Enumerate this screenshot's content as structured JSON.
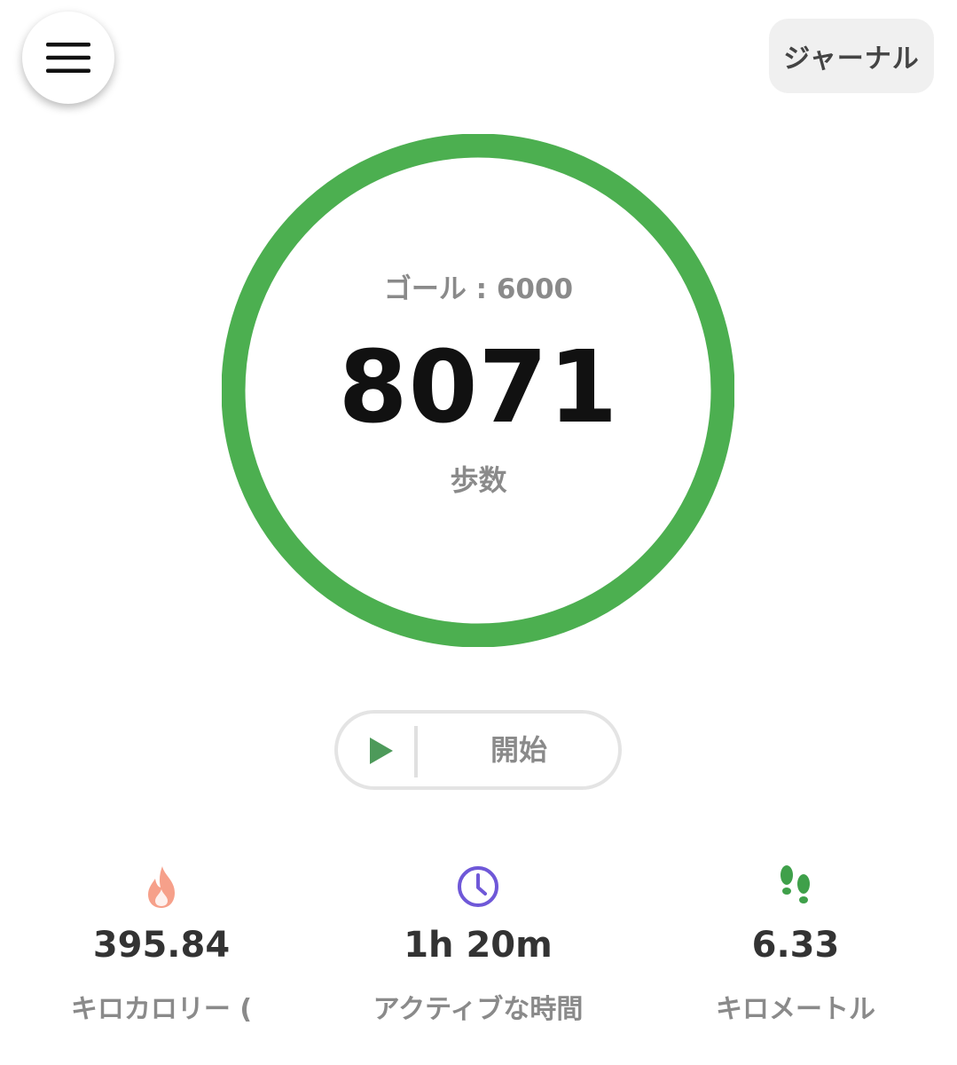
{
  "header": {
    "menu_icon": "hamburger-menu-icon",
    "journal_label": "ジャーナル"
  },
  "goal": {
    "text": "ゴール : 6000",
    "target": 6000
  },
  "steps": {
    "value": "8071",
    "label": "歩数",
    "progress_fraction": 1.0
  },
  "start_button": {
    "icon": "play-icon",
    "label": "開始"
  },
  "stats": [
    {
      "icon": "flame-icon",
      "value": "395.84",
      "label": "キロカロリー ("
    },
    {
      "icon": "clock-icon",
      "value": "1h 20m",
      "label": "アクティブな時間"
    },
    {
      "icon": "footprints-icon",
      "value": "6.33",
      "label": "キロメートル"
    }
  ],
  "colors": {
    "ring_green": "#4caf50",
    "play_green": "#4d9a5a",
    "flame": "#f6a08a",
    "clock": "#6f58d8",
    "footprints": "#3fa04a"
  }
}
